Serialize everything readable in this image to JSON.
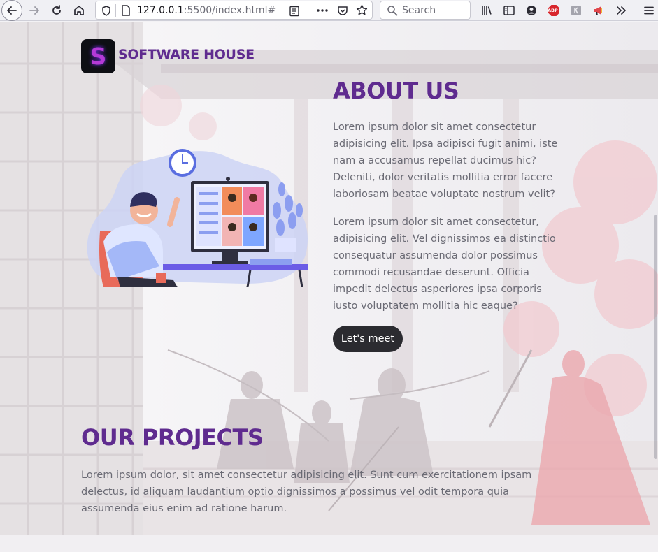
{
  "browser": {
    "url_host": "127.0.0.1",
    "url_rest": ":5500/index.html#",
    "search_placeholder": "Search",
    "adblock_label": "ABP"
  },
  "site": {
    "brand_letter": "S",
    "brand_name": "SOFTWARE HOUSE"
  },
  "about": {
    "title": "ABOUT US",
    "paragraph1": "Lorem ipsum dolor sit amet consectetur adipisicing elit. Ipsa adipisci fugit animi, iste nam a accusamus repellat ducimus hic? Deleniti, dolor veritatis mollitia error facere laboriosam beatae voluptate nostrum velit?",
    "paragraph2": "Lorem ipsum dolor sit amet consectetur, adipisicing elit. Vel dignissimos ea distinctio consequatur assumenda dolor possimus commodi recusandae deserunt. Officia impedit delectus asperiores ipsa corporis iusto voluptatem mollitia hic eaque?",
    "button_label": "Let's meet"
  },
  "projects": {
    "title": "OUR PROJECTS",
    "paragraph": "Lorem ipsum dolor, sit amet consectetur adipisicing elit. Sunt cum exercitationem ipsam delectus, id aliquam laudantium optio dignissimos a possimus vel odit tempora quia assumenda eius enim ad ratione harum."
  },
  "colors": {
    "accent": "#5f2b8f",
    "button_bg": "#2b2b30",
    "body_text": "#6a6a74"
  }
}
